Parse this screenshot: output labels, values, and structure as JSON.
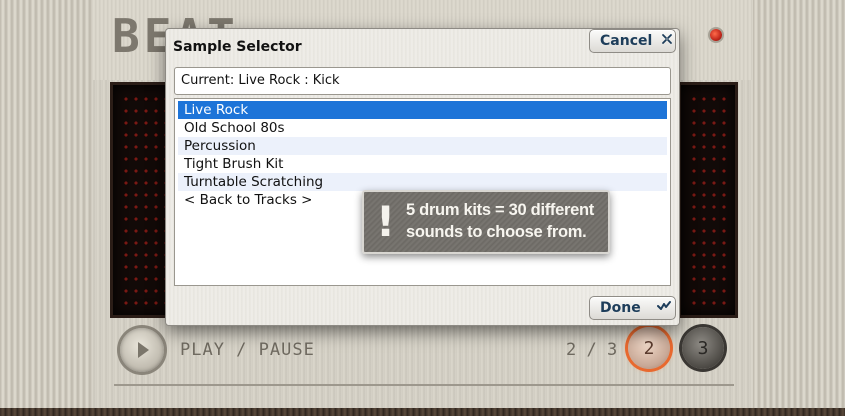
{
  "dialog": {
    "title": "Sample Selector",
    "cancel_label": "Cancel",
    "done_label": "Done",
    "current_value": "Current: Live Rock : Kick",
    "items": [
      {
        "label": "Live Rock",
        "selected": true
      },
      {
        "label": "Old School 80s",
        "selected": false
      },
      {
        "label": "Percussion",
        "selected": false
      },
      {
        "label": "Tight Brush Kit",
        "selected": false
      },
      {
        "label": "Turntable Scratching",
        "selected": false
      },
      {
        "label": "< Back to Tracks >",
        "selected": false
      }
    ]
  },
  "callout": {
    "mark": "!",
    "line1": "5 drum kits = 30 different",
    "line2": "sounds to choose from."
  },
  "device": {
    "logo_text": "BEAT",
    "play_label": "PLAY / PAUSE",
    "page_indicator": "2 / 3",
    "page_buttons": [
      "2",
      "3"
    ],
    "active_page": "2"
  },
  "icons": {
    "cancel": "close-x-icon",
    "done": "checkmark-icon",
    "play": "play-icon"
  },
  "colors": {
    "selection": "#1d74d8",
    "button_text": "#1d3d5a",
    "active_ring": "#e8692f",
    "led": "#c0261a"
  }
}
